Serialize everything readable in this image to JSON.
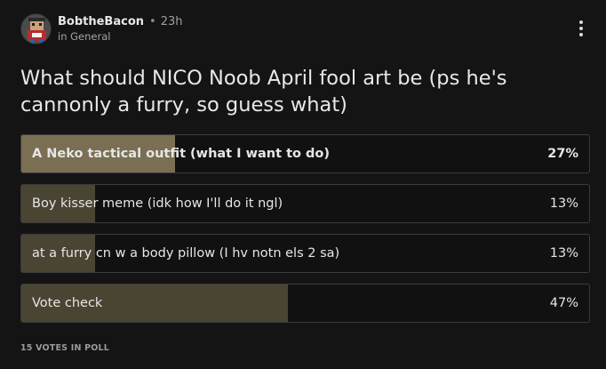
{
  "post": {
    "author": "BobtheBacon",
    "separator": "•",
    "time_ago": "23h",
    "community": "in General",
    "title": "What should NICO Noob April fool art be (ps he's cannonly a furry, so guess what)"
  },
  "poll": {
    "options": [
      {
        "label": "A Neko tactical outfit (what I want to do)",
        "percent_text": "27%",
        "percent": 27,
        "leading": true
      },
      {
        "label": "Boy kisser meme (idk how I'll do it ngl)",
        "percent_text": "13%",
        "percent": 13,
        "leading": false
      },
      {
        "label": "at a furry cn w a body pillow (I hv notn els 2 sa)",
        "percent_text": "13%",
        "percent": 13,
        "leading": false
      },
      {
        "label": "Vote check",
        "percent_text": "47%",
        "percent": 47,
        "leading": false
      }
    ],
    "votes_text": "15 VOTES IN POLL"
  },
  "icons": {
    "avatar": "user-avatar-icon",
    "more": "more-vertical-icon"
  },
  "colors": {
    "background": "#141414",
    "leading_fill": "#7a6f53",
    "fill": "#4a4433",
    "border": "#3b3b3b"
  }
}
